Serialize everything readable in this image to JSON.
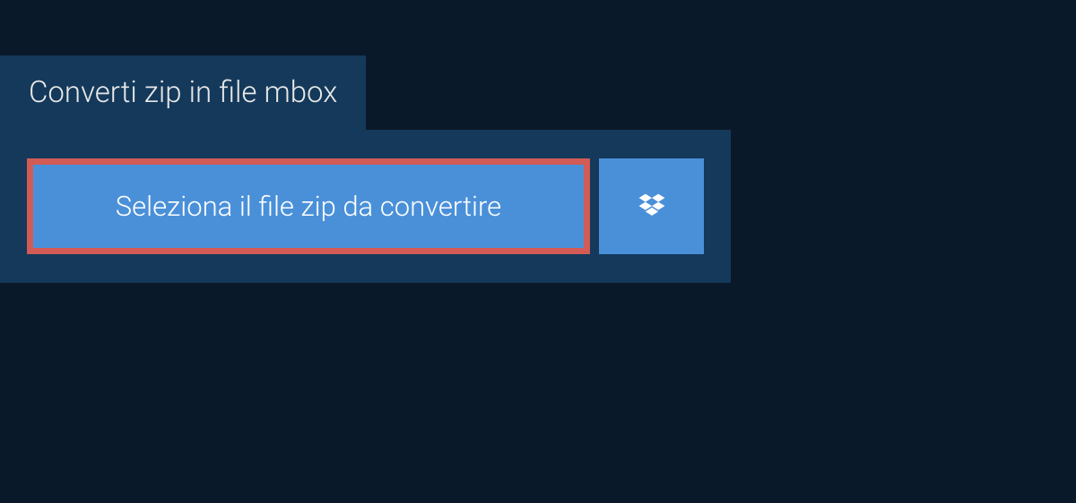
{
  "tab": {
    "title": "Converti zip in file mbox"
  },
  "buttons": {
    "select_file_label": "Seleziona il file zip da convertire"
  },
  "colors": {
    "background": "#0a1929",
    "panel": "#14395a",
    "button": "#4a90d9",
    "highlight_border": "#d25b55"
  }
}
